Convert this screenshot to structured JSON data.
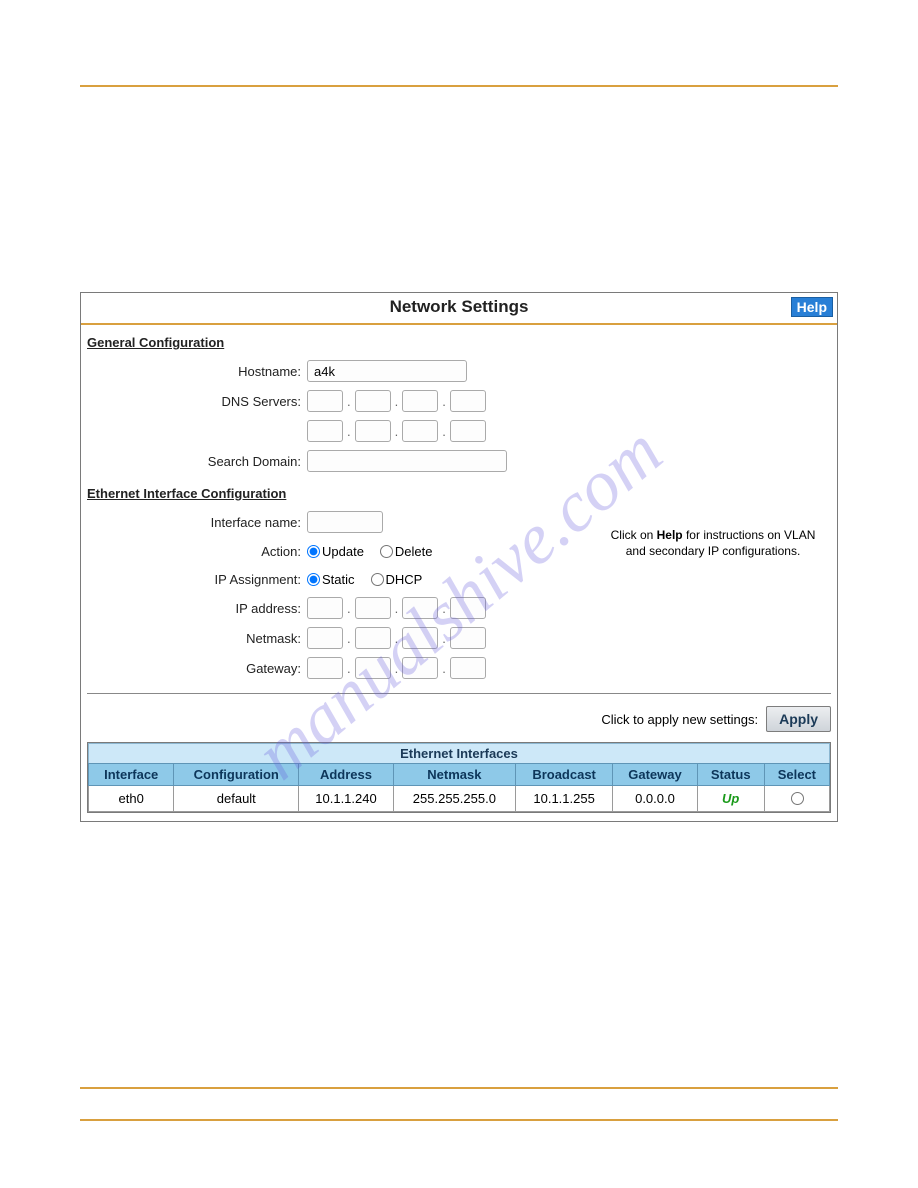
{
  "watermark": "manualshive.com",
  "panel": {
    "title": "Network Settings",
    "help_label": "Help"
  },
  "sections": {
    "general_title": "General Configuration",
    "ethernet_title": "Ethernet Interface Configuration"
  },
  "labels": {
    "hostname": "Hostname:",
    "dns_servers": "DNS Servers:",
    "search_domain": "Search Domain:",
    "interface_name": "Interface name:",
    "action": "Action:",
    "ip_assignment": "IP Assignment:",
    "ip_address": "IP address:",
    "netmask": "Netmask:",
    "gateway": "Gateway:"
  },
  "values": {
    "hostname": "a4k",
    "dns1": [
      "",
      "",
      "",
      ""
    ],
    "dns2": [
      "",
      "",
      "",
      ""
    ],
    "search_domain": "",
    "interface_name": "",
    "action_options": [
      "Update",
      "Delete"
    ],
    "action_selected": "Update",
    "ip_assign_options": [
      "Static",
      "DHCP"
    ],
    "ip_assign_selected": "Static",
    "ip_address": [
      "",
      "",
      "",
      ""
    ],
    "netmask": [
      "",
      "",
      "",
      ""
    ],
    "gateway": [
      "",
      "",
      "",
      ""
    ]
  },
  "side_note": {
    "line1_pre": "Click on ",
    "line1_bold": "Help",
    "line1_post": " for instructions on VLAN",
    "line2": "and secondary IP configurations."
  },
  "apply": {
    "prompt": "Click to apply new settings:",
    "button": "Apply"
  },
  "table": {
    "title": "Ethernet Interfaces",
    "headers": [
      "Interface",
      "Configuration",
      "Address",
      "Netmask",
      "Broadcast",
      "Gateway",
      "Status",
      "Select"
    ],
    "rows": [
      {
        "interface": "eth0",
        "configuration": "default",
        "address": "10.1.1.240",
        "netmask": "255.255.255.0",
        "broadcast": "10.1.1.255",
        "gateway": "0.0.0.0",
        "status": "Up",
        "selected": false
      }
    ]
  }
}
